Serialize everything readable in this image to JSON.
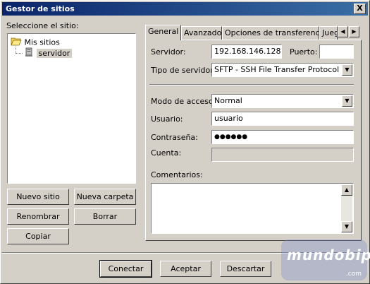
{
  "window": {
    "title": "Gestor de sitios",
    "close": "X"
  },
  "left": {
    "label": "Seleccione el sitio:",
    "tree": {
      "root": "Mis sitios",
      "child": "servidor"
    },
    "buttons": {
      "new_site": "Nuevo sitio",
      "new_folder": "Nueva carpeta",
      "rename": "Renombrar",
      "delete": "Borrar",
      "copy": "Copiar"
    }
  },
  "tabs": [
    "General",
    "Avanzado",
    "Opciones de transferencia",
    "Juego"
  ],
  "form": {
    "server_label": "Servidor:",
    "server_value": "192.168.146.128",
    "port_label": "Puerto:",
    "port_value": "",
    "server_type_label": "Tipo de servidor:",
    "server_type_value": "SFTP - SSH File Transfer Protocol",
    "access_mode_label": "Modo de acceso:",
    "access_mode_value": "Normal",
    "user_label": "Usuario:",
    "user_value": "usuario",
    "password_label": "Contraseña:",
    "password_value": "●●●●●●",
    "account_label": "Cuenta:",
    "account_value": "",
    "comments_label": "Comentarios:",
    "comments_value": ""
  },
  "bottom": {
    "connect": "Conectar",
    "accept": "Aceptar",
    "discard": "Descartar"
  },
  "watermark": {
    "text": "mundobip",
    "sub": ".com"
  }
}
